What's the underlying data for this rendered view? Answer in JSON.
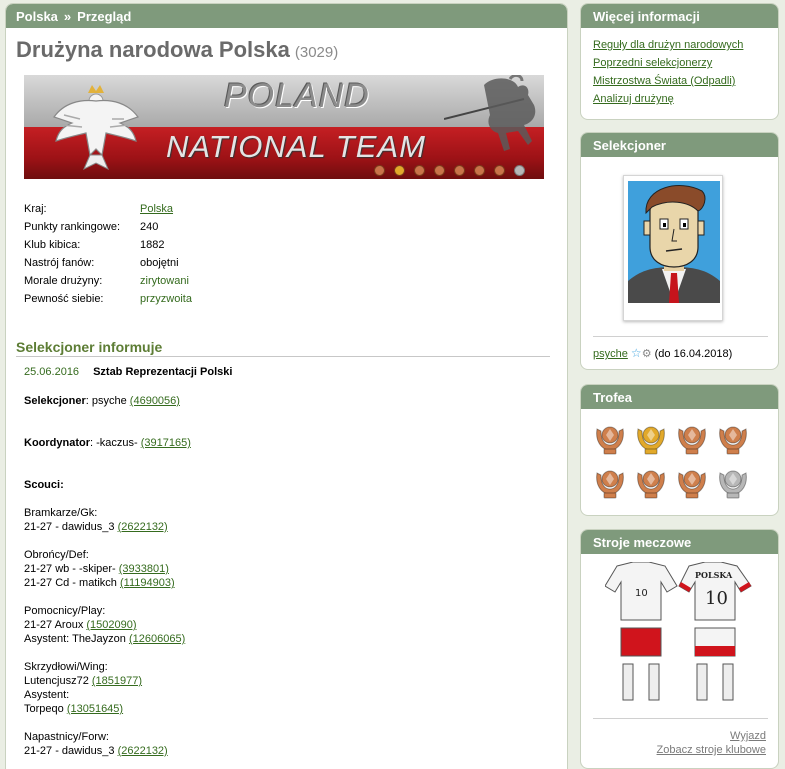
{
  "breadcrumb": {
    "country": "Polska",
    "separator": "»",
    "current": "Przegląd"
  },
  "title": {
    "name": "Drużyna narodowa Polska",
    "id": "(3029)"
  },
  "banner": {
    "line1": "POLAND",
    "line2": "NATIONAL TEAM"
  },
  "info": [
    {
      "label": "Kraj:",
      "value": "Polska",
      "link": true
    },
    {
      "label": "Punkty rankingowe:",
      "value": "240"
    },
    {
      "label": "Klub kibica:",
      "value": "1882"
    },
    {
      "label": "Nastrój fanów:",
      "value": "obojętni"
    },
    {
      "label": "Morale drużyny:",
      "value": "zirytowani",
      "green": true
    },
    {
      "label": "Pewność siebie:",
      "value": "przyzwoita",
      "green": true
    }
  ],
  "announce": {
    "title": "Selekcjoner informuje",
    "date": "25.06.2016",
    "author": "Sztab Reprezentacji Polski",
    "selekcjoner_label": "Selekcjoner",
    "selekcjoner_text": ": psyche ",
    "selekcjoner_id": "(4690056)",
    "koordynator_label": "Koordynator",
    "koordynator_text": ": -kaczus- ",
    "koordynator_id": "(3917165)",
    "scouts_label": "Scouci:",
    "gk_label": "Bramkarze/Gk:",
    "gk_1": "21-27 - dawidus_3 ",
    "gk_1_id": "(2622132)",
    "def_label": "Obrońcy/Def:",
    "def_1": "21-27 wb - -skiper- ",
    "def_1_id": "(3933801)",
    "def_2": "21-27 Cd - matikch ",
    "def_2_id": "(11194903)",
    "mid_label": "Pomocnicy/Play:",
    "mid_1": "21-27 Aroux ",
    "mid_1_id": "(1502090)",
    "mid_2": "Asystent: TheJayzon ",
    "mid_2_id": "(12606065)",
    "wing_label": "Skrzydłowi/Wing:",
    "wing_1": "Lutencjusz72 ",
    "wing_1_id": "(1851977)",
    "wing_2": "Asystent:",
    "wing_3": "Torpeqo ",
    "wing_3_id": "(13051645)",
    "fw_label": "Napastnicy/Forw:",
    "fw_1": "21-27 - dawidus_3 ",
    "fw_1_id": "(2622132)"
  },
  "sidebar": {
    "more": {
      "title": "Więcej informacji",
      "links": [
        "Reguły dla drużyn narodowych",
        "Poprzedni selekcjonerzy",
        "Mistrzostwa Świata (Odpadli)",
        "Analizuj drużynę"
      ]
    },
    "coach": {
      "title": "Selekcjoner",
      "name": "psyche",
      "until": "(do 16.04.2018)"
    },
    "trophies": {
      "title": "Trofea",
      "items": [
        "bronze",
        "gold",
        "bronze",
        "bronze",
        "bronze",
        "bronze",
        "bronze",
        "silver"
      ]
    },
    "kits": {
      "title": "Stroje meczowe",
      "number": "10",
      "kit2_name": "POLSKA",
      "away_link": "Wyjazd",
      "club_link": "Zobacz stroje klubowe"
    }
  },
  "colors": {
    "header": "#7f9a7c",
    "link": "#356b1e",
    "section": "#5d7d35",
    "gold": "#e2a92b",
    "bronze": "#cf7f4c",
    "silver": "#b7b7b7"
  }
}
